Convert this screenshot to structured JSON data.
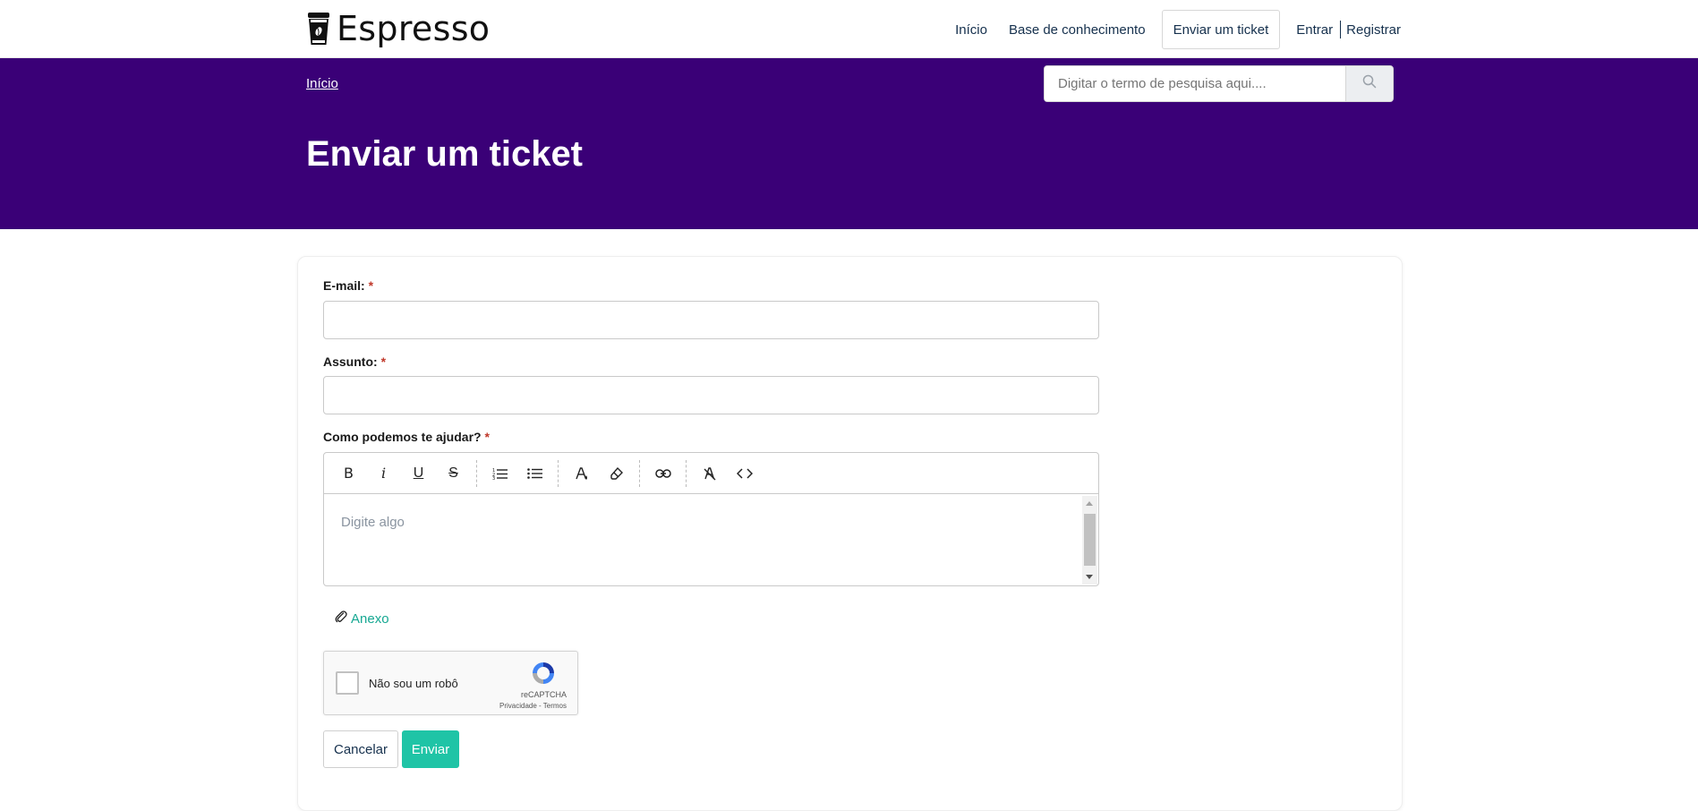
{
  "brand": {
    "name": "Espresso"
  },
  "nav": {
    "home": "Início",
    "knowledge_base": "Base de conhecimento",
    "submit_ticket": "Enviar um ticket",
    "sign_in": "Entrar",
    "register": "Registrar"
  },
  "hero": {
    "breadcrumb": "Início",
    "search_placeholder": "Digitar o termo de pesquisa aqui....",
    "title": "Enviar um ticket",
    "background_color": "#3a0077"
  },
  "form": {
    "email_label": "E-mail:",
    "subject_label": "Assunto:",
    "message_label": "Como podemos te ajudar?",
    "required_mark": "*",
    "editor_placeholder": "Digite algo",
    "toolbar": [
      "bold",
      "italic",
      "underline",
      "strikethrough",
      "ordered-list",
      "bullet-list",
      "text-color",
      "highlight",
      "link",
      "clear-format",
      "code"
    ],
    "attachment_label": "Anexo",
    "captcha": {
      "label": "Não sou um robô",
      "brand": "reCAPTCHA",
      "links": "Privacidade - Termos"
    },
    "cancel_label": "Cancelar",
    "submit_label": "Enviar",
    "accent_color": "#1fc4a6"
  }
}
